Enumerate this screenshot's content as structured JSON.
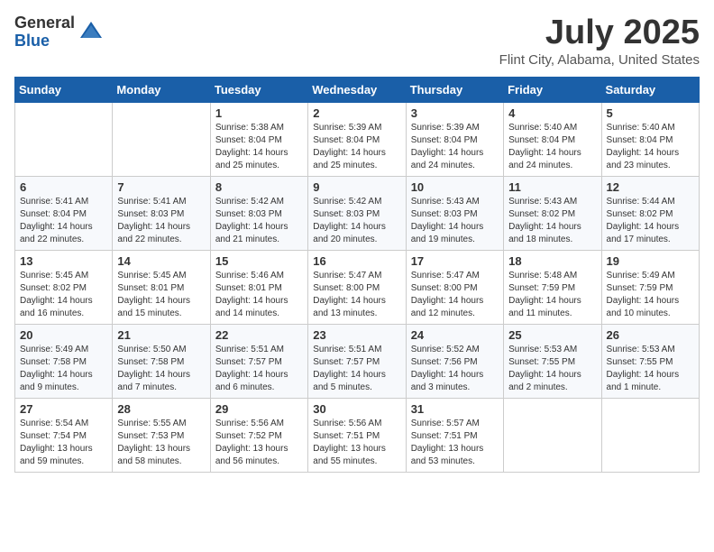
{
  "logo": {
    "general": "General",
    "blue": "Blue"
  },
  "title": "July 2025",
  "location": "Flint City, Alabama, United States",
  "weekdays": [
    "Sunday",
    "Monday",
    "Tuesday",
    "Wednesday",
    "Thursday",
    "Friday",
    "Saturday"
  ],
  "weeks": [
    [
      {
        "day": "",
        "detail": ""
      },
      {
        "day": "",
        "detail": ""
      },
      {
        "day": "1",
        "detail": "Sunrise: 5:38 AM\nSunset: 8:04 PM\nDaylight: 14 hours and 25 minutes."
      },
      {
        "day": "2",
        "detail": "Sunrise: 5:39 AM\nSunset: 8:04 PM\nDaylight: 14 hours and 25 minutes."
      },
      {
        "day": "3",
        "detail": "Sunrise: 5:39 AM\nSunset: 8:04 PM\nDaylight: 14 hours and 24 minutes."
      },
      {
        "day": "4",
        "detail": "Sunrise: 5:40 AM\nSunset: 8:04 PM\nDaylight: 14 hours and 24 minutes."
      },
      {
        "day": "5",
        "detail": "Sunrise: 5:40 AM\nSunset: 8:04 PM\nDaylight: 14 hours and 23 minutes."
      }
    ],
    [
      {
        "day": "6",
        "detail": "Sunrise: 5:41 AM\nSunset: 8:04 PM\nDaylight: 14 hours and 22 minutes."
      },
      {
        "day": "7",
        "detail": "Sunrise: 5:41 AM\nSunset: 8:03 PM\nDaylight: 14 hours and 22 minutes."
      },
      {
        "day": "8",
        "detail": "Sunrise: 5:42 AM\nSunset: 8:03 PM\nDaylight: 14 hours and 21 minutes."
      },
      {
        "day": "9",
        "detail": "Sunrise: 5:42 AM\nSunset: 8:03 PM\nDaylight: 14 hours and 20 minutes."
      },
      {
        "day": "10",
        "detail": "Sunrise: 5:43 AM\nSunset: 8:03 PM\nDaylight: 14 hours and 19 minutes."
      },
      {
        "day": "11",
        "detail": "Sunrise: 5:43 AM\nSunset: 8:02 PM\nDaylight: 14 hours and 18 minutes."
      },
      {
        "day": "12",
        "detail": "Sunrise: 5:44 AM\nSunset: 8:02 PM\nDaylight: 14 hours and 17 minutes."
      }
    ],
    [
      {
        "day": "13",
        "detail": "Sunrise: 5:45 AM\nSunset: 8:02 PM\nDaylight: 14 hours and 16 minutes."
      },
      {
        "day": "14",
        "detail": "Sunrise: 5:45 AM\nSunset: 8:01 PM\nDaylight: 14 hours and 15 minutes."
      },
      {
        "day": "15",
        "detail": "Sunrise: 5:46 AM\nSunset: 8:01 PM\nDaylight: 14 hours and 14 minutes."
      },
      {
        "day": "16",
        "detail": "Sunrise: 5:47 AM\nSunset: 8:00 PM\nDaylight: 14 hours and 13 minutes."
      },
      {
        "day": "17",
        "detail": "Sunrise: 5:47 AM\nSunset: 8:00 PM\nDaylight: 14 hours and 12 minutes."
      },
      {
        "day": "18",
        "detail": "Sunrise: 5:48 AM\nSunset: 7:59 PM\nDaylight: 14 hours and 11 minutes."
      },
      {
        "day": "19",
        "detail": "Sunrise: 5:49 AM\nSunset: 7:59 PM\nDaylight: 14 hours and 10 minutes."
      }
    ],
    [
      {
        "day": "20",
        "detail": "Sunrise: 5:49 AM\nSunset: 7:58 PM\nDaylight: 14 hours and 9 minutes."
      },
      {
        "day": "21",
        "detail": "Sunrise: 5:50 AM\nSunset: 7:58 PM\nDaylight: 14 hours and 7 minutes."
      },
      {
        "day": "22",
        "detail": "Sunrise: 5:51 AM\nSunset: 7:57 PM\nDaylight: 14 hours and 6 minutes."
      },
      {
        "day": "23",
        "detail": "Sunrise: 5:51 AM\nSunset: 7:57 PM\nDaylight: 14 hours and 5 minutes."
      },
      {
        "day": "24",
        "detail": "Sunrise: 5:52 AM\nSunset: 7:56 PM\nDaylight: 14 hours and 3 minutes."
      },
      {
        "day": "25",
        "detail": "Sunrise: 5:53 AM\nSunset: 7:55 PM\nDaylight: 14 hours and 2 minutes."
      },
      {
        "day": "26",
        "detail": "Sunrise: 5:53 AM\nSunset: 7:55 PM\nDaylight: 14 hours and 1 minute."
      }
    ],
    [
      {
        "day": "27",
        "detail": "Sunrise: 5:54 AM\nSunset: 7:54 PM\nDaylight: 13 hours and 59 minutes."
      },
      {
        "day": "28",
        "detail": "Sunrise: 5:55 AM\nSunset: 7:53 PM\nDaylight: 13 hours and 58 minutes."
      },
      {
        "day": "29",
        "detail": "Sunrise: 5:56 AM\nSunset: 7:52 PM\nDaylight: 13 hours and 56 minutes."
      },
      {
        "day": "30",
        "detail": "Sunrise: 5:56 AM\nSunset: 7:51 PM\nDaylight: 13 hours and 55 minutes."
      },
      {
        "day": "31",
        "detail": "Sunrise: 5:57 AM\nSunset: 7:51 PM\nDaylight: 13 hours and 53 minutes."
      },
      {
        "day": "",
        "detail": ""
      },
      {
        "day": "",
        "detail": ""
      }
    ]
  ]
}
